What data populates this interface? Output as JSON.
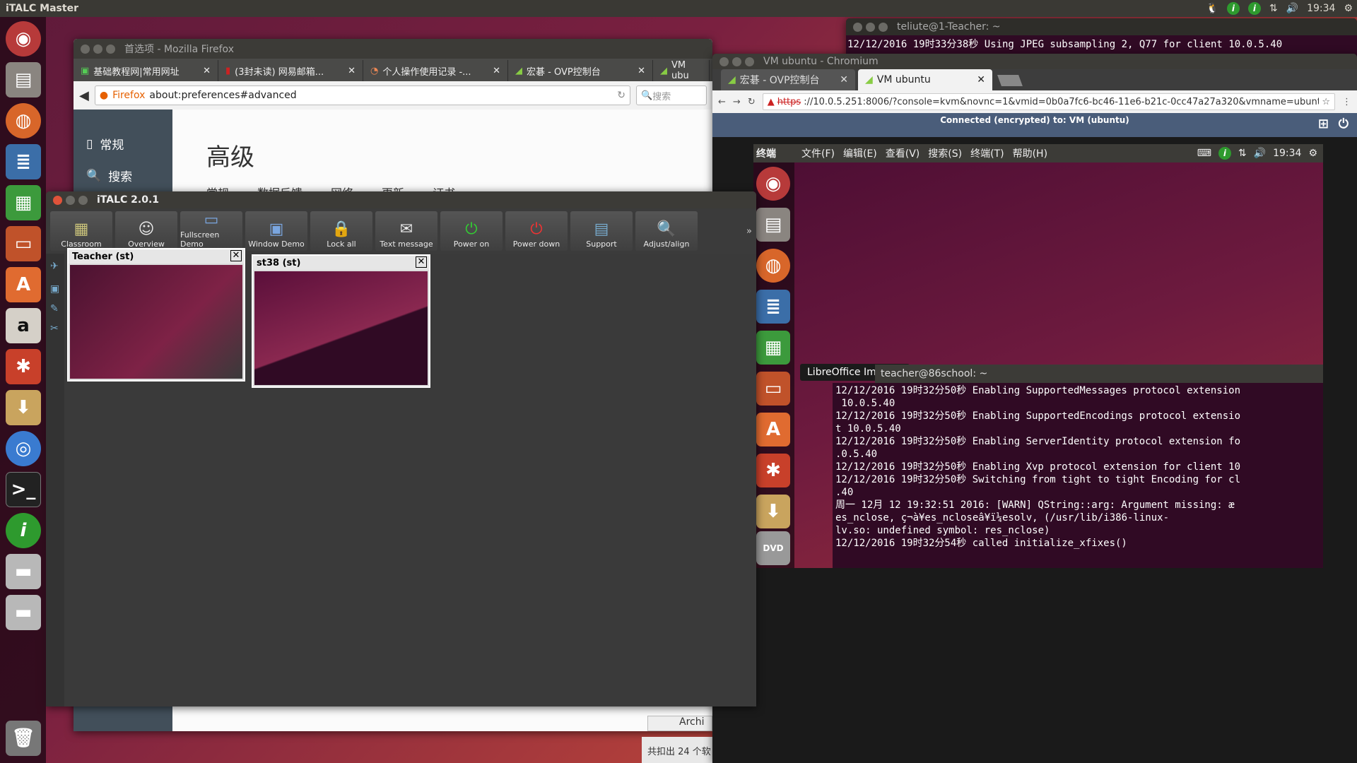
{
  "topbar": {
    "app_title": "iTALC Master",
    "clock": "19:34"
  },
  "teacher_terminal": {
    "title": "teliute@1-Teacher: ~",
    "line": "12/12/2016 19时33分38秒 Using JPEG subsampling 2, Q77 for client 10.0.5.40"
  },
  "firefox": {
    "title": "首选项 - Mozilla Firefox",
    "tabs": [
      {
        "label": "基础教程网|常用网址"
      },
      {
        "label": "(3封未读) 网易邮箱..."
      },
      {
        "label": "个人操作使用记录 -..."
      },
      {
        "label": "宏碁 - OVP控制台"
      },
      {
        "label": "VM ubu"
      }
    ],
    "brand": "Firefox",
    "url": "about:preferences#advanced",
    "search_placeholder": "搜索",
    "sidebar": [
      {
        "label": "常规"
      },
      {
        "label": "搜索"
      }
    ],
    "heading": "高级",
    "subtabs": [
      "常规",
      "数据反馈",
      "网络",
      "更新",
      "证书"
    ],
    "footer_button": "Archi",
    "footer_text": "共扣出 24 个软"
  },
  "italc": {
    "title": "iTALC 2.0.1",
    "toolbar": [
      {
        "label": "Classroom"
      },
      {
        "label": "Overview"
      },
      {
        "label": "Fullscreen Demo"
      },
      {
        "label": "Window Demo"
      },
      {
        "label": "Lock all"
      },
      {
        "label": "Text message"
      },
      {
        "label": "Power on"
      },
      {
        "label": "Power down"
      },
      {
        "label": "Support"
      },
      {
        "label": "Adjust/align"
      }
    ],
    "clients": [
      {
        "name": "Teacher (st)"
      },
      {
        "name": "st38 (st)"
      }
    ]
  },
  "chromium": {
    "title": "VM ubuntu - Chromium",
    "tabs": [
      {
        "label": "宏碁 - OVP控制台"
      },
      {
        "label": "VM ubuntu"
      }
    ],
    "url_scheme": "https",
    "url_rest": "://10.0.5.251:8006/?console=kvm&novnc=1&vmid=0b0a7fc6-bc46-11e6-b21c-0cc47a27a320&vmname=ubuntu",
    "status": "Connected (encrypted) to: VM (ubuntu)"
  },
  "vm": {
    "menu_title": "终端",
    "menus": [
      "文件(F)",
      "编辑(E)",
      "查看(V)",
      "搜索(S)",
      "终端(T)",
      "帮助(H)"
    ],
    "clock": "19:34",
    "tooltip": "LibreOffice Impress",
    "terminal_title": "teacher@86school: ~",
    "terminal_lines": [
      "12/12/2016 19时32分50秒 Enabling SupportedMessages protocol extension",
      " 10.0.5.40",
      "12/12/2016 19时32分50秒 Enabling SupportedEncodings protocol extensio",
      "t 10.0.5.40",
      "12/12/2016 19时32分50秒 Enabling ServerIdentity protocol extension fo",
      ".0.5.40",
      "12/12/2016 19时32分50秒 Enabling Xvp protocol extension for client 10",
      "12/12/2016 19时32分50秒 Switching from tight to tight Encoding for cl",
      ".40",
      "周一 12月 12 19:32:51 2016: [WARN] QString::arg: Argument missing: æ",
      "es_nclose, ç¬à¥es_ncloseâ¥ï¼esolv, (/usr/lib/i386-linux-",
      "lv.so: undefined symbol: res_nclose)",
      "12/12/2016 19时32分54秒 called initialize_xfixes()"
    ]
  },
  "colors": {
    "accent_orange": "#e95420",
    "launcher_bg": "#2a0a19",
    "italc_bg": "#3a3a3a"
  }
}
